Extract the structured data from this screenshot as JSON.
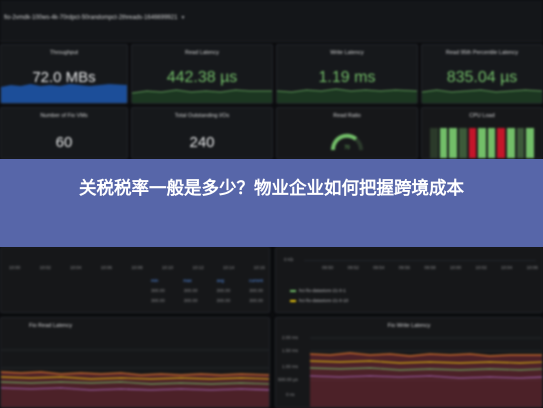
{
  "topbar": {
    "dashboard_name": "fio-2vmdk-100ws-4k-70rdpct-50randompct-2threads-1646699921",
    "caret_icon": "chevron-down-icon"
  },
  "row1": [
    {
      "id": "throughput",
      "title": "Throughput",
      "value": "72.0 MBs",
      "style": "blue"
    },
    {
      "id": "read-latency",
      "title": "Read Latency",
      "value": "442.38 µs",
      "style": "green"
    },
    {
      "id": "write-latency",
      "title": "Write Latency",
      "value": "1.19 ms",
      "style": "green"
    },
    {
      "id": "read-95th",
      "title": "Read 95th Percentile Latency",
      "value": "835.04 µs",
      "style": "green"
    }
  ],
  "row2": [
    {
      "id": "fio-vms",
      "title": "Number of Fio VMs",
      "value": "60"
    },
    {
      "id": "outstanding-ios",
      "title": "Total Outstanding I/Os",
      "value": "240"
    },
    {
      "id": "read-ratio",
      "title": "Read Ratio",
      "gauge_value": "70"
    },
    {
      "id": "cpu-load",
      "title": "CPU Load"
    }
  ],
  "banner": {
    "text": "关税税率一般是多少？物业企业如何把握跨境成本"
  },
  "mid_left": {
    "x_ticks": [
      "10:00",
      "10:02",
      "10:04",
      "10:06",
      "10:08",
      "10:10",
      "10:12",
      "10:14",
      "10:16"
    ],
    "table_headers": [
      "min",
      "max",
      "avg",
      "current"
    ],
    "table_rows": [
      [
        "300.00",
        "300.00",
        "300.00",
        "300.00"
      ],
      [
        "300.00",
        "300.00",
        "300.00",
        "300.00"
      ]
    ]
  },
  "mid_right": {
    "y_top": "0 Kb",
    "x_ticks": [
      "09:50",
      "09:52",
      "09:54",
      "09:56",
      "09:58",
      "10:00",
      "10:02",
      "10:04",
      "10:06"
    ],
    "legend": [
      {
        "label": "hci-fio-datastore-21-0-1",
        "color": "#73bf69"
      },
      {
        "label": "hci-fio-datastore-21-0-10",
        "color": "#f2cc0c"
      }
    ]
  },
  "bottom_left": {
    "title": "Fio Read Latency"
  },
  "bottom_right": {
    "title": "Fio Write Latency",
    "y_ticks": [
      "2.00 ms",
      "1.50 ms",
      "1.00 ms",
      "500.00 µs",
      "0 ns"
    ]
  },
  "colors": {
    "background": "#0b0c0e",
    "panel": "#161719",
    "green": "#73bf69",
    "blue_spark": "#1f60c4",
    "banner": "#5f70ba",
    "red": "#c4162a"
  }
}
